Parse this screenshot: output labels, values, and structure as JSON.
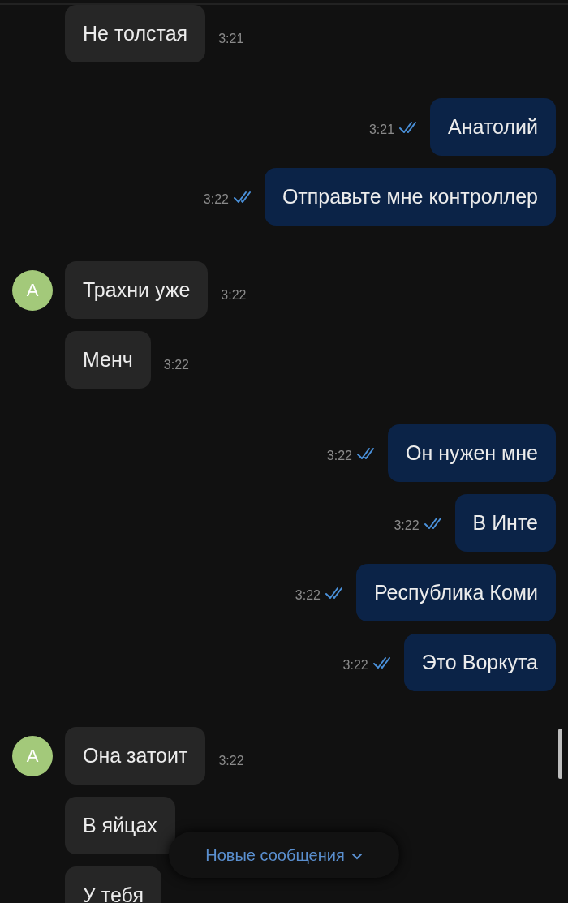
{
  "groups": [
    {
      "kind": "incoming",
      "messages": [
        {
          "text": "Не толстая",
          "time": "3:21"
        }
      ]
    },
    {
      "kind": "outgoing",
      "messages": [
        {
          "text": "Анатолий",
          "time": "3:21",
          "read": true
        },
        {
          "text": "Отправьте мне контроллер",
          "time": "3:22",
          "read": true
        }
      ]
    },
    {
      "kind": "incoming",
      "avatar": "А",
      "messages": [
        {
          "text": "Трахни уже",
          "time": "3:22"
        },
        {
          "text": "Менч",
          "time": "3:22"
        }
      ]
    },
    {
      "kind": "outgoing",
      "messages": [
        {
          "text": "Он нужен мне",
          "time": "3:22",
          "read": true
        },
        {
          "text": "В Инте",
          "time": "3:22",
          "read": true
        },
        {
          "text": "Республика Коми",
          "time": "3:22",
          "read": true
        },
        {
          "text": "Это Воркута",
          "time": "3:22",
          "read": true
        }
      ]
    },
    {
      "kind": "incoming",
      "avatar": "А",
      "messages": [
        {
          "text": "Она затоит",
          "time": "3:22"
        },
        {
          "text": "В яйцах"
        },
        {
          "text": "У тебя"
        }
      ]
    }
  ],
  "new_messages_button": {
    "label": "Новые сообщения"
  }
}
